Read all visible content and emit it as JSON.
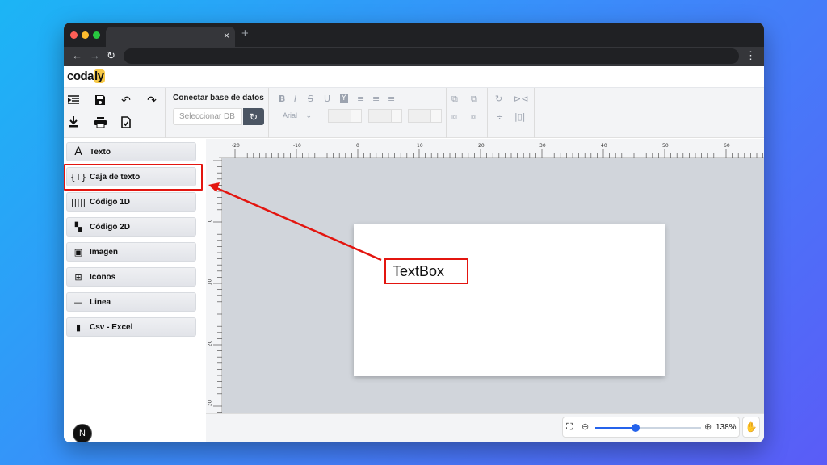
{
  "app": {
    "logo_text": "codaly"
  },
  "browser": {
    "tab_close": "×",
    "new_tab": "+"
  },
  "toolbar": {
    "db_title": "Conectar base de datos",
    "db_placeholder": "Seleccionar DB",
    "font_value": "Arial"
  },
  "sidebar": {
    "items": [
      {
        "label": "Texto",
        "icon": "text-icon"
      },
      {
        "label": "Caja de texto",
        "icon": "textbox-icon"
      },
      {
        "label": "Código 1D",
        "icon": "barcode-icon"
      },
      {
        "label": "Código 2D",
        "icon": "qrcode-icon"
      },
      {
        "label": "Imagen",
        "icon": "image-icon"
      },
      {
        "label": "Iconos",
        "icon": "grid-icon"
      },
      {
        "label": "Linea",
        "icon": "line-icon"
      },
      {
        "label": "Csv - Excel",
        "icon": "file-icon"
      }
    ],
    "avatar": "N"
  },
  "ruler": {
    "h_labels": [
      "-20",
      "-10",
      "0",
      "10",
      "20",
      "30",
      "40",
      "50",
      "60"
    ],
    "v_labels": [
      "0",
      "10",
      "20",
      "30"
    ]
  },
  "zoom": {
    "value": 0.38,
    "label": "138%"
  },
  "annotation": {
    "callout": "TextBox",
    "color": "#e3150f"
  }
}
